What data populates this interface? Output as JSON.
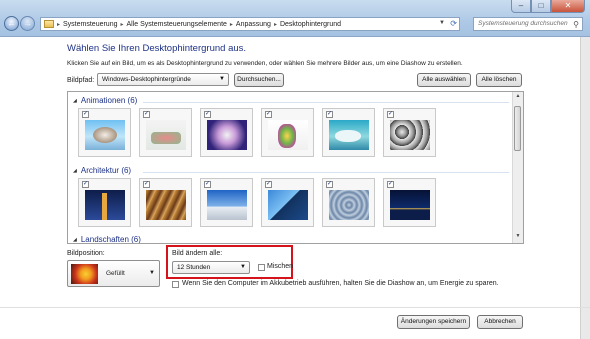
{
  "nav": {
    "breadcrumb": [
      "Systemsteuerung",
      "Alle Systemsteuerungselemente",
      "Anpassung",
      "Desktophintergrund"
    ],
    "search_placeholder": "Systemsteuerung durchsuchen"
  },
  "page": {
    "heading": "Wählen Sie Ihren Desktophintergrund aus.",
    "subtext": "Klicken Sie auf ein Bild, um es als Desktophintergrund zu verwenden, oder wählen Sie mehrere Bilder aus, um eine Diashow zu erstellen."
  },
  "bildpfad": {
    "label": "Bildpfad:",
    "value": "Windows-Desktophintergründe",
    "browse_label": "Durchsuchen...",
    "select_all_label": "Alle auswählen",
    "clear_all_label": "Alle löschen"
  },
  "gallery": {
    "groups": [
      {
        "title": "Animationen (6)",
        "count": 6
      },
      {
        "title": "Architektur (6)",
        "count": 6
      },
      {
        "title": "Landschaften (6)",
        "count": 6
      }
    ],
    "checked_mark": "✓"
  },
  "position": {
    "label": "Bildposition:",
    "value": "Gefüllt"
  },
  "interval": {
    "label": "Bild ändern alle:",
    "value": "12 Stunden",
    "shuffle_label": "Mischen"
  },
  "battery": {
    "label": "Wenn Sie den Computer im Akkubetrieb ausführen, halten Sie die Diashow an, um Energie zu sparen."
  },
  "footer": {
    "save_label": "Änderungen speichern",
    "cancel_label": "Abbrechen"
  }
}
